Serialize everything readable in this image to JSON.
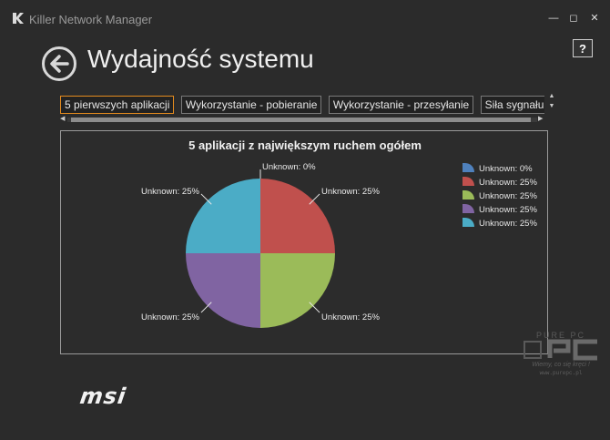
{
  "window": {
    "title": "Killer Network Manager",
    "logo_letter": "K",
    "minimize": "—",
    "maximize": "◻",
    "close": "✕",
    "help": "?"
  },
  "page": {
    "title": "Wydajność systemu"
  },
  "tabs": [
    {
      "label": "5 pierwszych aplikacji",
      "active": true
    },
    {
      "label": "Wykorzystanie - pobieranie",
      "active": false
    },
    {
      "label": "Wykorzystanie - przesyłanie",
      "active": false
    },
    {
      "label": "Siła sygnału bezprz",
      "active": false
    }
  ],
  "chart_data": {
    "type": "pie",
    "title": "5 aplikacji z największym ruchem ogółem",
    "slices": [
      {
        "label": "Unknown: 0%",
        "value": 0,
        "color": "#4f81bd"
      },
      {
        "label": "Unknown: 25%",
        "value": 25,
        "color": "#c0504d"
      },
      {
        "label": "Unknown: 25%",
        "value": 25,
        "color": "#9bbb59"
      },
      {
        "label": "Unknown: 25%",
        "value": 25,
        "color": "#8064a2"
      },
      {
        "label": "Unknown: 25%",
        "value": 25,
        "color": "#4bacc6"
      }
    ],
    "legend_position": "top-right"
  },
  "brand": {
    "logo_text": "msi"
  },
  "watermark": {
    "text": "PURE PC",
    "slogan": "Wiemy, co się kręci !",
    "url": "www.purepc.pl"
  }
}
